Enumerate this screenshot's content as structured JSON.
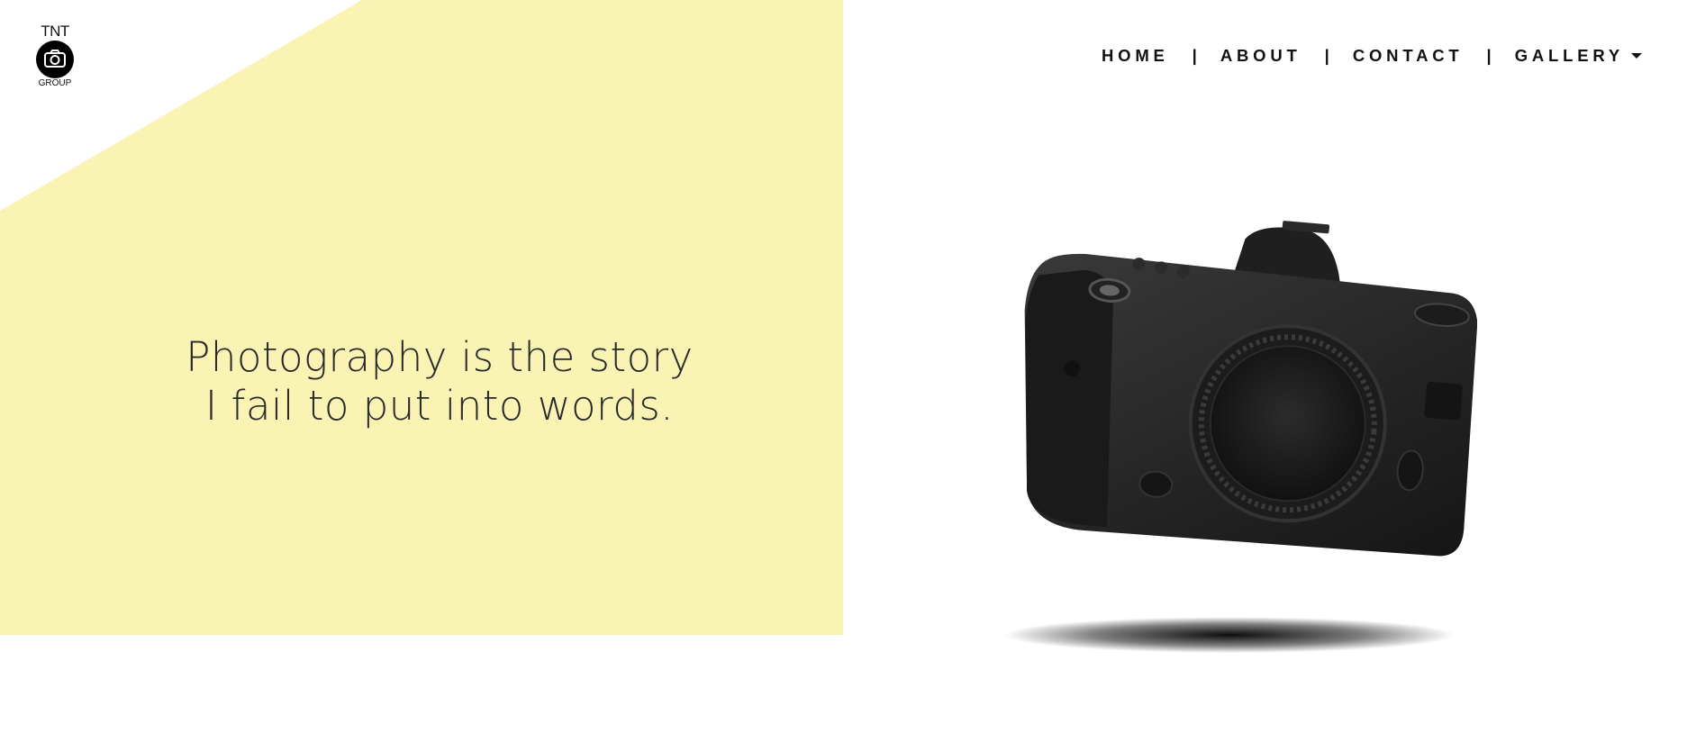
{
  "brand": {
    "top_text": "TNT",
    "bottom_text": "GROUP",
    "logo_icon": "camera-icon"
  },
  "nav": {
    "items": [
      {
        "label": "HOME"
      },
      {
        "label": "ABOUT"
      },
      {
        "label": "CONTACT"
      },
      {
        "label": "GALLERY",
        "has_dropdown": true
      }
    ],
    "separator": "|"
  },
  "hero": {
    "line1": "Photography is the story",
    "line2": "I fail to put into words.",
    "image": "dslr-camera"
  },
  "colors": {
    "accent_yellow": "#f9f3b4",
    "text": "#111111",
    "background": "#ffffff"
  }
}
